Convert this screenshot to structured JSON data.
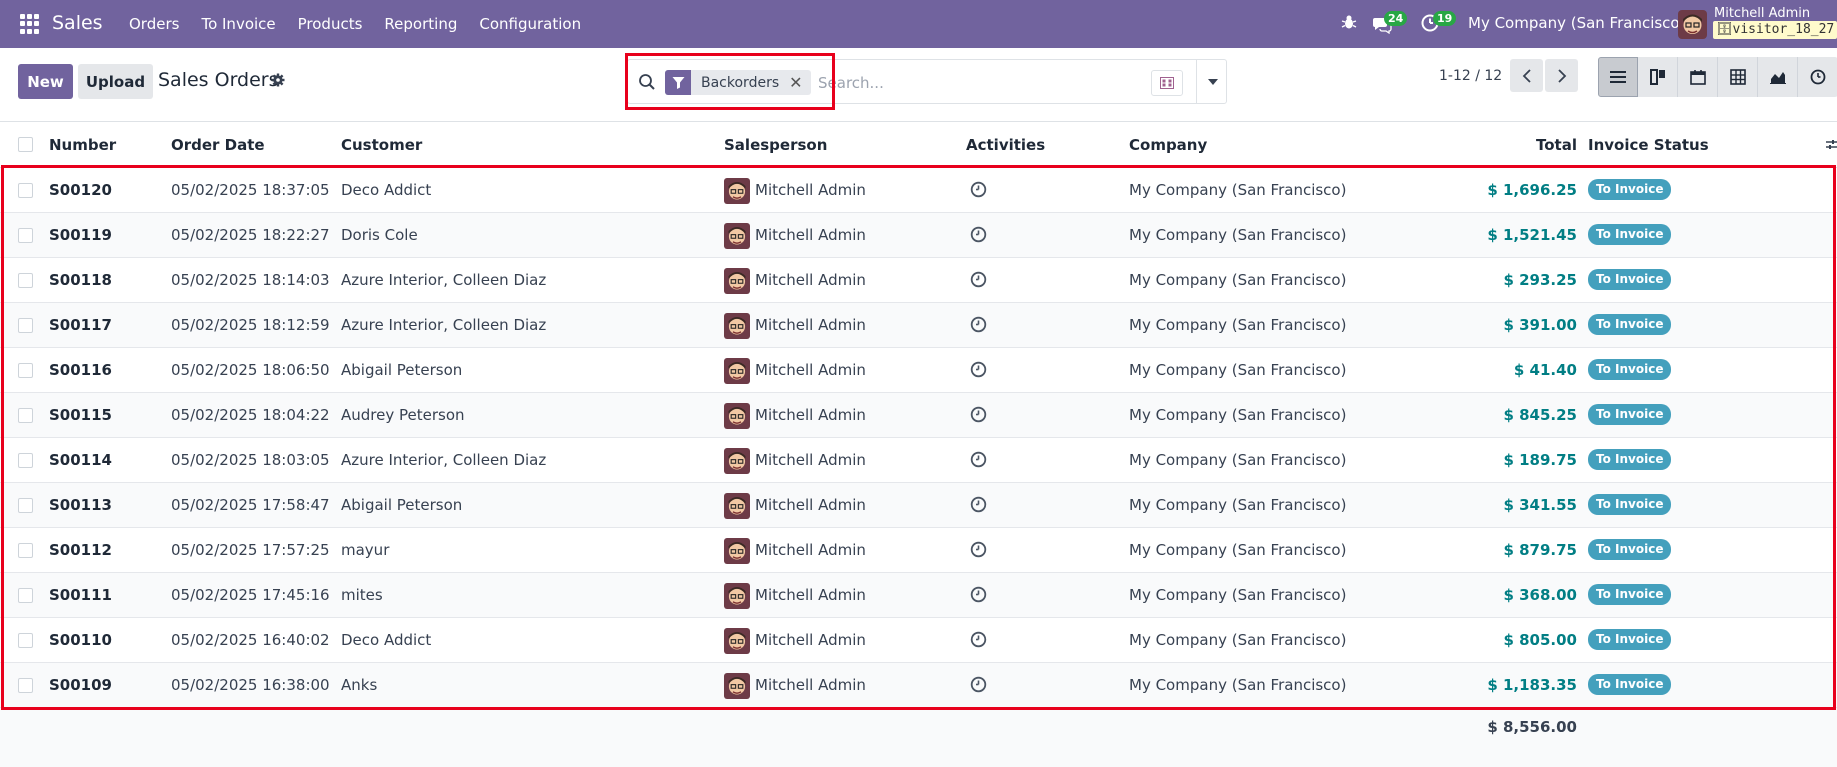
{
  "navbar": {
    "app_name": "Sales",
    "menu": [
      "Orders",
      "To Invoice",
      "Products",
      "Reporting",
      "Configuration"
    ],
    "messages_count": "24",
    "activities_count": "19",
    "company": "My Company (San Francisco)",
    "user": "Mitchell Admin",
    "database": "visitor_18_27",
    "color": "#71639e"
  },
  "control": {
    "new_label": "New",
    "upload_label": "Upload",
    "title": "Sales Orders",
    "facet_label": "Backorders",
    "search_placeholder": "Search...",
    "pager": "1-12 / 12"
  },
  "columns": {
    "number": "Number",
    "order_date": "Order Date",
    "customer": "Customer",
    "salesperson": "Salesperson",
    "activities": "Activities",
    "company": "Company",
    "total": "Total",
    "invoice_status": "Invoice Status"
  },
  "rows": [
    {
      "number": "S00120",
      "date": "05/02/2025 18:37:05",
      "customer": "Deco Addict",
      "salesperson": "Mitchell Admin",
      "company": "My Company (San Francisco)",
      "total": "$ 1,696.25",
      "status": "To Invoice"
    },
    {
      "number": "S00119",
      "date": "05/02/2025 18:22:27",
      "customer": "Doris Cole",
      "salesperson": "Mitchell Admin",
      "company": "My Company (San Francisco)",
      "total": "$ 1,521.45",
      "status": "To Invoice"
    },
    {
      "number": "S00118",
      "date": "05/02/2025 18:14:03",
      "customer": "Azure Interior, Colleen Diaz",
      "salesperson": "Mitchell Admin",
      "company": "My Company (San Francisco)",
      "total": "$ 293.25",
      "status": "To Invoice"
    },
    {
      "number": "S00117",
      "date": "05/02/2025 18:12:59",
      "customer": "Azure Interior, Colleen Diaz",
      "salesperson": "Mitchell Admin",
      "company": "My Company (San Francisco)",
      "total": "$ 391.00",
      "status": "To Invoice"
    },
    {
      "number": "S00116",
      "date": "05/02/2025 18:06:50",
      "customer": "Abigail Peterson",
      "salesperson": "Mitchell Admin",
      "company": "My Company (San Francisco)",
      "total": "$ 41.40",
      "status": "To Invoice"
    },
    {
      "number": "S00115",
      "date": "05/02/2025 18:04:22",
      "customer": "Audrey Peterson",
      "salesperson": "Mitchell Admin",
      "company": "My Company (San Francisco)",
      "total": "$ 845.25",
      "status": "To Invoice"
    },
    {
      "number": "S00114",
      "date": "05/02/2025 18:03:05",
      "customer": "Azure Interior, Colleen Diaz",
      "salesperson": "Mitchell Admin",
      "company": "My Company (San Francisco)",
      "total": "$ 189.75",
      "status": "To Invoice"
    },
    {
      "number": "S00113",
      "date": "05/02/2025 17:58:47",
      "customer": "Abigail Peterson",
      "salesperson": "Mitchell Admin",
      "company": "My Company (San Francisco)",
      "total": "$ 341.55",
      "status": "To Invoice"
    },
    {
      "number": "S00112",
      "date": "05/02/2025 17:57:25",
      "customer": "mayur",
      "salesperson": "Mitchell Admin",
      "company": "My Company (San Francisco)",
      "total": "$ 879.75",
      "status": "To Invoice"
    },
    {
      "number": "S00111",
      "date": "05/02/2025 17:45:16",
      "customer": "mites",
      "salesperson": "Mitchell Admin",
      "company": "My Company (San Francisco)",
      "total": "$ 368.00",
      "status": "To Invoice"
    },
    {
      "number": "S00110",
      "date": "05/02/2025 16:40:02",
      "customer": "Deco Addict",
      "salesperson": "Mitchell Admin",
      "company": "My Company (San Francisco)",
      "total": "$ 805.00",
      "status": "To Invoice"
    },
    {
      "number": "S00109",
      "date": "05/02/2025 16:38:00",
      "customer": "Anks",
      "salesperson": "Mitchell Admin",
      "company": "My Company (San Francisco)",
      "total": "$ 1,183.35",
      "status": "To Invoice"
    }
  ],
  "footer_total": "$ 8,556.00",
  "colors": {
    "accent": "#71639e",
    "total_text": "#017e84",
    "status_badge": "#44a0bd",
    "highlight": "#e8001c"
  }
}
